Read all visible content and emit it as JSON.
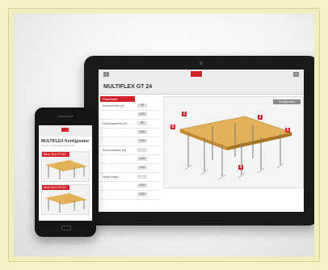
{
  "tablet": {
    "title": "MULTIFLEX GT 24",
    "left_tab": "Parameter",
    "config_button": "Konfiguration speichern",
    "rows": [
      {
        "label": "Betonierhöhe [m]",
        "value": "25"
      },
      {
        "label": "",
        "value": "0.00"
      },
      {
        "label": "Schalungsdicke [m]",
        "value": "30"
      },
      {
        "label": "",
        "value": "0.00"
      },
      {
        "label": "",
        "value": "0.00"
      },
      {
        "label": "Deckenstützen [m]",
        "value": ""
      },
      {
        "label": "",
        "value": "0.00"
      },
      {
        "label": "",
        "value": "0.00"
      },
      {
        "label": "Haupt-träger",
        "value": ""
      },
      {
        "label": "",
        "value": "0.00"
      },
      {
        "label": "",
        "value": "0.00"
      }
    ],
    "markers": [
      "1",
      "2",
      "3",
      "4",
      "5"
    ]
  },
  "phone": {
    "title": "MULTIFLEX Konfigurator",
    "subtitle": "Schnell- und Mobilkonfiguration",
    "cards": [
      {
        "label": "Neue MULTIFLEX GT"
      },
      {
        "label": "Neue MULTIFLEX GT"
      }
    ]
  },
  "colors": {
    "brand": "#d2232a",
    "frame_bg": "#f7f1c8",
    "device": "#1a1a1a"
  }
}
